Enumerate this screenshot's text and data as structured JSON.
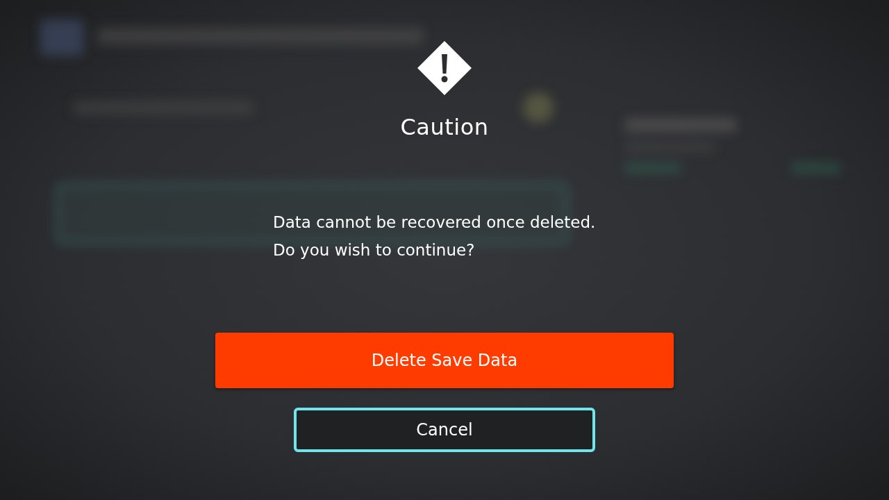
{
  "dialog": {
    "title": "Caution",
    "message": [
      "Data cannot be recovered once deleted.",
      "Do you wish to continue?"
    ],
    "buttons": [
      {
        "label": "Delete Save Data",
        "kind": "danger",
        "selected": false
      },
      {
        "label": "Cancel",
        "kind": "plain",
        "selected": true
      }
    ]
  }
}
